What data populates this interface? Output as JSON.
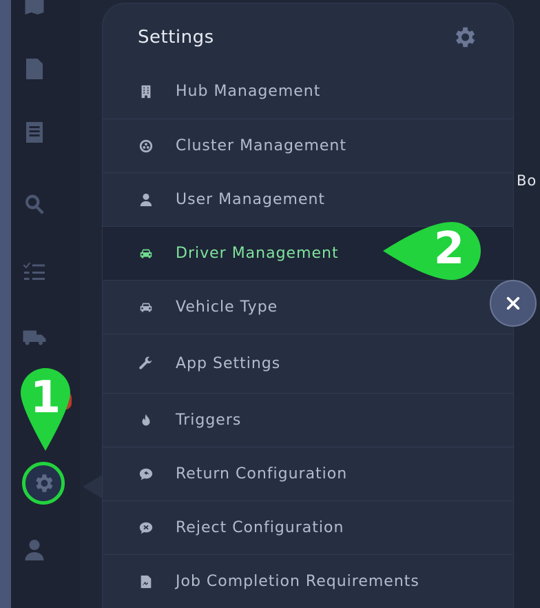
{
  "rail": {
    "icons": [
      "map-icon",
      "edit-document-icon",
      "receipt-icon",
      "search-icon",
      "checklist-icon",
      "truck-icon",
      "settings-icon",
      "user-icon"
    ]
  },
  "panel": {
    "title": "Settings",
    "items": [
      {
        "label": "Hub Management",
        "icon": "building-icon"
      },
      {
        "label": "Cluster Management",
        "icon": "cluster-icon"
      },
      {
        "label": "User Management",
        "icon": "user-icon"
      },
      {
        "label": "Driver Management",
        "icon": "car-icon",
        "active": true
      },
      {
        "label": "Vehicle Type",
        "icon": "car-icon"
      },
      {
        "label": "App Settings",
        "icon": "wrench-icon"
      },
      {
        "label": "Triggers",
        "icon": "fire-icon"
      },
      {
        "label": "Return Configuration",
        "icon": "return-chat-icon"
      },
      {
        "label": "Reject Configuration",
        "icon": "reject-chat-icon"
      },
      {
        "label": "Job Completion Requirements",
        "icon": "signature-icon"
      }
    ]
  },
  "background_text": "Bo",
  "callouts": {
    "step1": "1",
    "step2": "2"
  },
  "colors": {
    "accent": "#22d33d",
    "active_text": "#7fe39d",
    "panel_bg": "#262f42"
  }
}
